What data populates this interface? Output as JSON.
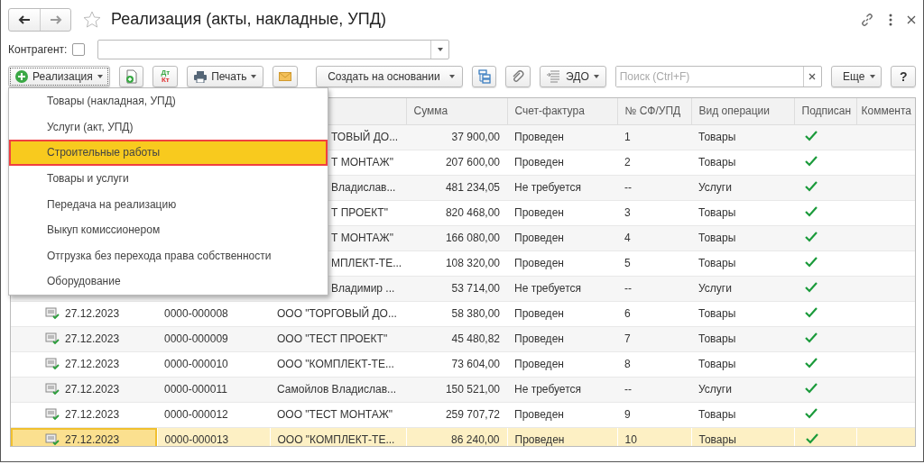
{
  "window": {
    "title": "Реализация (акты, накладные, УПД)",
    "favorite": false
  },
  "filter": {
    "label": "Контрагент:",
    "checked": false
  },
  "toolbar": {
    "create_button": "Реализация",
    "dtkt": {
      "top": "Дт",
      "bottom": "Кт"
    },
    "print_button": "Печать",
    "based_on_button": "Создать на основании",
    "edo_button": "ЭДО",
    "search": {
      "placeholder": "Поиск (Ctrl+F)"
    },
    "more_button": "Еще",
    "help_button": "?"
  },
  "create_menu": [
    {
      "label": "Товары (накладная, УПД)",
      "selected": false
    },
    {
      "label": "Услуги (акт, УПД)",
      "selected": false
    },
    {
      "label": "Строительные работы",
      "selected": true
    },
    {
      "label": "Товары и услуги",
      "selected": false
    },
    {
      "label": "Передача на реализацию",
      "selected": false
    },
    {
      "label": "Выкуп комиссионером",
      "selected": false
    },
    {
      "label": "Отгрузка без перехода права собственности",
      "selected": false
    },
    {
      "label": "Оборудование",
      "selected": false
    }
  ],
  "table": {
    "columns": [
      "Сумма",
      "Счет-фактура",
      "№ СФ/УПД",
      "Вид операции",
      "Подписан",
      "Коммента"
    ],
    "rows": [
      {
        "counterparty": "ТОВЫЙ ДО...",
        "sum": "37 900,00",
        "invoice": "Проведен",
        "invoice_no": "1",
        "operation": "Товары",
        "signed": true,
        "selected": false
      },
      {
        "counterparty": "Т МОНТАЖ\"",
        "sum": "207 600,00",
        "invoice": "Проведен",
        "invoice_no": "2",
        "operation": "Товары",
        "signed": true,
        "selected": false
      },
      {
        "counterparty": "Владислав...",
        "sum": "481 234,05",
        "invoice": "Не требуется",
        "invoice_no": "--",
        "operation": "Услуги",
        "signed": true,
        "selected": false
      },
      {
        "counterparty": "Т ПРОЕКТ\"",
        "sum": "820 468,00",
        "invoice": "Проведен",
        "invoice_no": "3",
        "operation": "Товары",
        "signed": true,
        "selected": false
      },
      {
        "counterparty": "Т МОНТАЖ\"",
        "sum": "166 080,00",
        "invoice": "Проведен",
        "invoice_no": "4",
        "operation": "Товары",
        "signed": true,
        "selected": false
      },
      {
        "counterparty": "МПЛЕКТ-ТЕ...",
        "sum": "108 320,00",
        "invoice": "Проведен",
        "invoice_no": "5",
        "operation": "Товары",
        "signed": true,
        "selected": false
      },
      {
        "counterparty": "Владимир ...",
        "sum": "53 714,00",
        "invoice": "Не требуется",
        "invoice_no": "--",
        "operation": "Услуги",
        "signed": true,
        "selected": false
      },
      {
        "date": "27.12.2023",
        "number": "0000-000008",
        "counterparty": "ООО \"ТОРГОВЫЙ ДО...",
        "sum": "58 380,00",
        "invoice": "Проведен",
        "invoice_no": "6",
        "operation": "Товары",
        "signed": true,
        "selected": false
      },
      {
        "date": "27.12.2023",
        "number": "0000-000009",
        "counterparty": "ООО \"ТЕСТ ПРОЕКТ\"",
        "sum": "45 480,82",
        "invoice": "Проведен",
        "invoice_no": "7",
        "operation": "Товары",
        "signed": true,
        "selected": false
      },
      {
        "date": "27.12.2023",
        "number": "0000-000010",
        "counterparty": "ООО \"КОМПЛЕКТ-ТЕ...",
        "sum": "73 604,00",
        "invoice": "Проведен",
        "invoice_no": "8",
        "operation": "Товары",
        "signed": true,
        "selected": false
      },
      {
        "date": "27.12.2023",
        "number": "0000-000011",
        "counterparty": "Самойлов Владислав...",
        "sum": "150 521,00",
        "invoice": "Не требуется",
        "invoice_no": "--",
        "operation": "Услуги",
        "signed": true,
        "selected": false
      },
      {
        "date": "27.12.2023",
        "number": "0000-000012",
        "counterparty": "ООО \"ТЕСТ МОНТАЖ\"",
        "sum": "259 707,72",
        "invoice": "Проведен",
        "invoice_no": "9",
        "operation": "Товары",
        "signed": true,
        "selected": false
      },
      {
        "date": "27.12.2023",
        "number": "0000-000013",
        "counterparty": "ООО \"КОМПЛЕКТ-ТЕ...",
        "sum": "86 240,00",
        "invoice": "Проведен",
        "invoice_no": "10",
        "operation": "Товары",
        "signed": true,
        "selected": true
      }
    ]
  }
}
